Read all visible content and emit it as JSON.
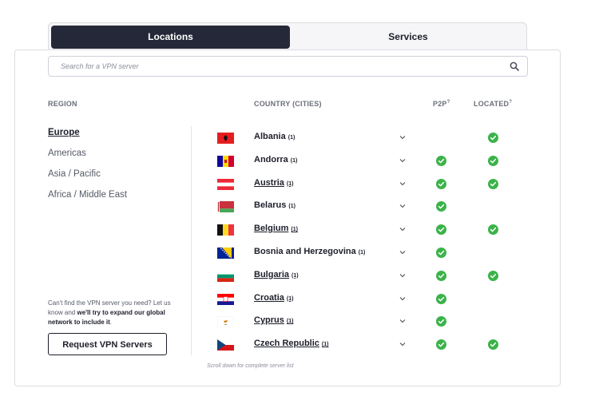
{
  "tabs": [
    {
      "label": "Locations",
      "active": true
    },
    {
      "label": "Services",
      "active": false
    }
  ],
  "search": {
    "placeholder": "Search for a VPN server"
  },
  "headers": {
    "region": "REGION",
    "country": "COUNTRY (CITIES)",
    "p2p": "P2P",
    "located": "LOCATED",
    "help_mark": "?"
  },
  "regions": [
    "Europe",
    "Americas",
    "Asia / Pacific",
    "Africa / Middle East"
  ],
  "active_region": "Europe",
  "countries": [
    {
      "name": "Albania",
      "cities": "(1)",
      "flag": "albania",
      "p2p": false,
      "located": true,
      "underlined": false
    },
    {
      "name": "Andorra",
      "cities": "(1)",
      "flag": "andorra",
      "p2p": true,
      "located": true,
      "underlined": false
    },
    {
      "name": "Austria",
      "cities": "(1)",
      "flag": "austria",
      "p2p": true,
      "located": true,
      "underlined": true
    },
    {
      "name": "Belarus",
      "cities": "(1)",
      "flag": "belarus",
      "p2p": true,
      "located": false,
      "underlined": false
    },
    {
      "name": "Belgium",
      "cities": "(1)",
      "flag": "belgium",
      "p2p": true,
      "located": true,
      "underlined": true
    },
    {
      "name": "Bosnia and Herzegovina",
      "cities": "(1)",
      "flag": "bosnia",
      "p2p": true,
      "located": false,
      "underlined": false
    },
    {
      "name": "Bulgaria",
      "cities": "(1)",
      "flag": "bulgaria",
      "p2p": true,
      "located": true,
      "underlined": true
    },
    {
      "name": "Croatia",
      "cities": "(1)",
      "flag": "croatia",
      "p2p": true,
      "located": false,
      "underlined": true
    },
    {
      "name": "Cyprus",
      "cities": "(1)",
      "flag": "cyprus",
      "p2p": true,
      "located": false,
      "underlined": true
    },
    {
      "name": "Czech Republic",
      "cities": "(1)",
      "flag": "czech",
      "p2p": true,
      "located": true,
      "underlined": true
    }
  ],
  "help": {
    "line1": "Can't find the VPN server you need? Let us know and ",
    "bold": "we'll try to expand our global network to include it",
    "end": "."
  },
  "request_button": "Request VPN Servers",
  "scroll_note": "Scroll down for complete server list",
  "colors": {
    "dark": "#242838",
    "check": "#3bb34a"
  }
}
